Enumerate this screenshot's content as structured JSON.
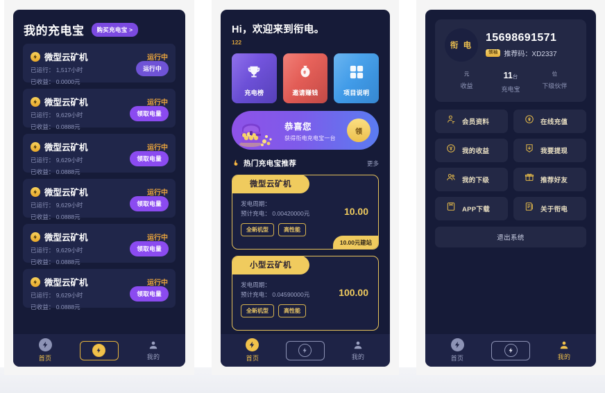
{
  "panel1": {
    "title": "我的充电宝",
    "buy_button": "购买充电宝 >",
    "runtime_label": "已运行：",
    "income_label": "已收益：",
    "miners": [
      {
        "name": "微型云矿机",
        "status": "运行中",
        "runtime": "已运行： 1,517小时",
        "income": "已收益： 0.0000元",
        "action": "运行中",
        "action_type": "run"
      },
      {
        "name": "微型云矿机",
        "status": "运行中",
        "runtime": "已运行： 9,629小时",
        "income": "已收益： 0.0888元",
        "action": "领取电量",
        "action_type": "claim"
      },
      {
        "name": "微型云矿机",
        "status": "运行中",
        "runtime": "已运行： 9,629小时",
        "income": "已收益： 0.0888元",
        "action": "领取电量",
        "action_type": "claim"
      },
      {
        "name": "微型云矿机",
        "status": "运行中",
        "runtime": "已运行： 9,629小时",
        "income": "已收益： 0.0888元",
        "action": "领取电量",
        "action_type": "claim"
      },
      {
        "name": "微型云矿机",
        "status": "运行中",
        "runtime": "已运行： 9,629小时",
        "income": "已收益： 0.0888元",
        "action": "领取电量",
        "action_type": "claim"
      },
      {
        "name": "微型云矿机",
        "status": "运行中",
        "runtime": "已运行： 9,629小时",
        "income": "已收益： 0.0888元",
        "action": "领取电量",
        "action_type": "claim"
      }
    ],
    "tabbar": {
      "home": "首页",
      "center": "charge-icon",
      "mine": "我的",
      "active": "home"
    }
  },
  "panel2": {
    "greeting": "Hi，欢迎来到衔电。",
    "count": "122",
    "quick_cards": [
      {
        "label": "充电榜",
        "icon": "trophy-icon",
        "color": "#6b4fd6"
      },
      {
        "label": "邀请赚钱",
        "icon": "money-bag-icon",
        "color": "#e05a54"
      },
      {
        "label": "项目说明",
        "icon": "grid-icon",
        "color": "#3f9ae8"
      }
    ],
    "banner": {
      "title": "恭喜您",
      "subtitle": "获得衔电充电宝一台",
      "button": "领"
    },
    "section": {
      "title": "热门充电宝推荐",
      "more": "更多",
      "icon": "flame-icon"
    },
    "products": [
      {
        "name": "微型云矿机",
        "cycle": "发电周期：",
        "estimate": "预计充电： 0.00420000元",
        "tags": [
          "全新机型",
          "高性能"
        ],
        "price": "10.00",
        "footer": "10.00元建站"
      },
      {
        "name": "小型云矿机",
        "cycle": "发电周期：",
        "estimate": "预计充电： 0.04590000元",
        "tags": [
          "全新机型",
          "高性能"
        ],
        "price": "100.00",
        "footer": ""
      }
    ],
    "tabbar": {
      "home": "首页",
      "center": "charge-icon",
      "mine": "我的",
      "active": "home"
    }
  },
  "panel3": {
    "profile": {
      "avatar_text": "衔 电",
      "phone": "15698691571",
      "badge": "领袖",
      "referral": "推荐码：XD2337"
    },
    "stats": [
      {
        "value": "",
        "unit": "元",
        "label": "收益"
      },
      {
        "value": "11",
        "unit": "台",
        "label": "充电宝"
      },
      {
        "value": "",
        "unit": "位",
        "label": "下级伙伴"
      }
    ],
    "menu": [
      {
        "label": "会员资料",
        "icon": "user-icon"
      },
      {
        "label": "在线充值",
        "icon": "coin-icon"
      },
      {
        "label": "我的收益",
        "icon": "earnings-icon"
      },
      {
        "label": "我要提现",
        "icon": "withdraw-icon"
      },
      {
        "label": "我的下级",
        "icon": "team-icon"
      },
      {
        "label": "推荐好友",
        "icon": "gift-icon"
      },
      {
        "label": "APP下载",
        "icon": "download-icon"
      },
      {
        "label": "关于衔电",
        "icon": "document-icon"
      }
    ],
    "logout": "退出系统",
    "tabbar": {
      "home": "首页",
      "center": "charge-icon",
      "mine": "我的",
      "active": "mine"
    }
  },
  "colors": {
    "page_bg": "#ffffff",
    "panel_bg": "#161b38",
    "card_bg": "#20264a",
    "gold": "#f0cb5e",
    "purple": "#8b4bf0",
    "status_orange": "#e8a33d"
  }
}
